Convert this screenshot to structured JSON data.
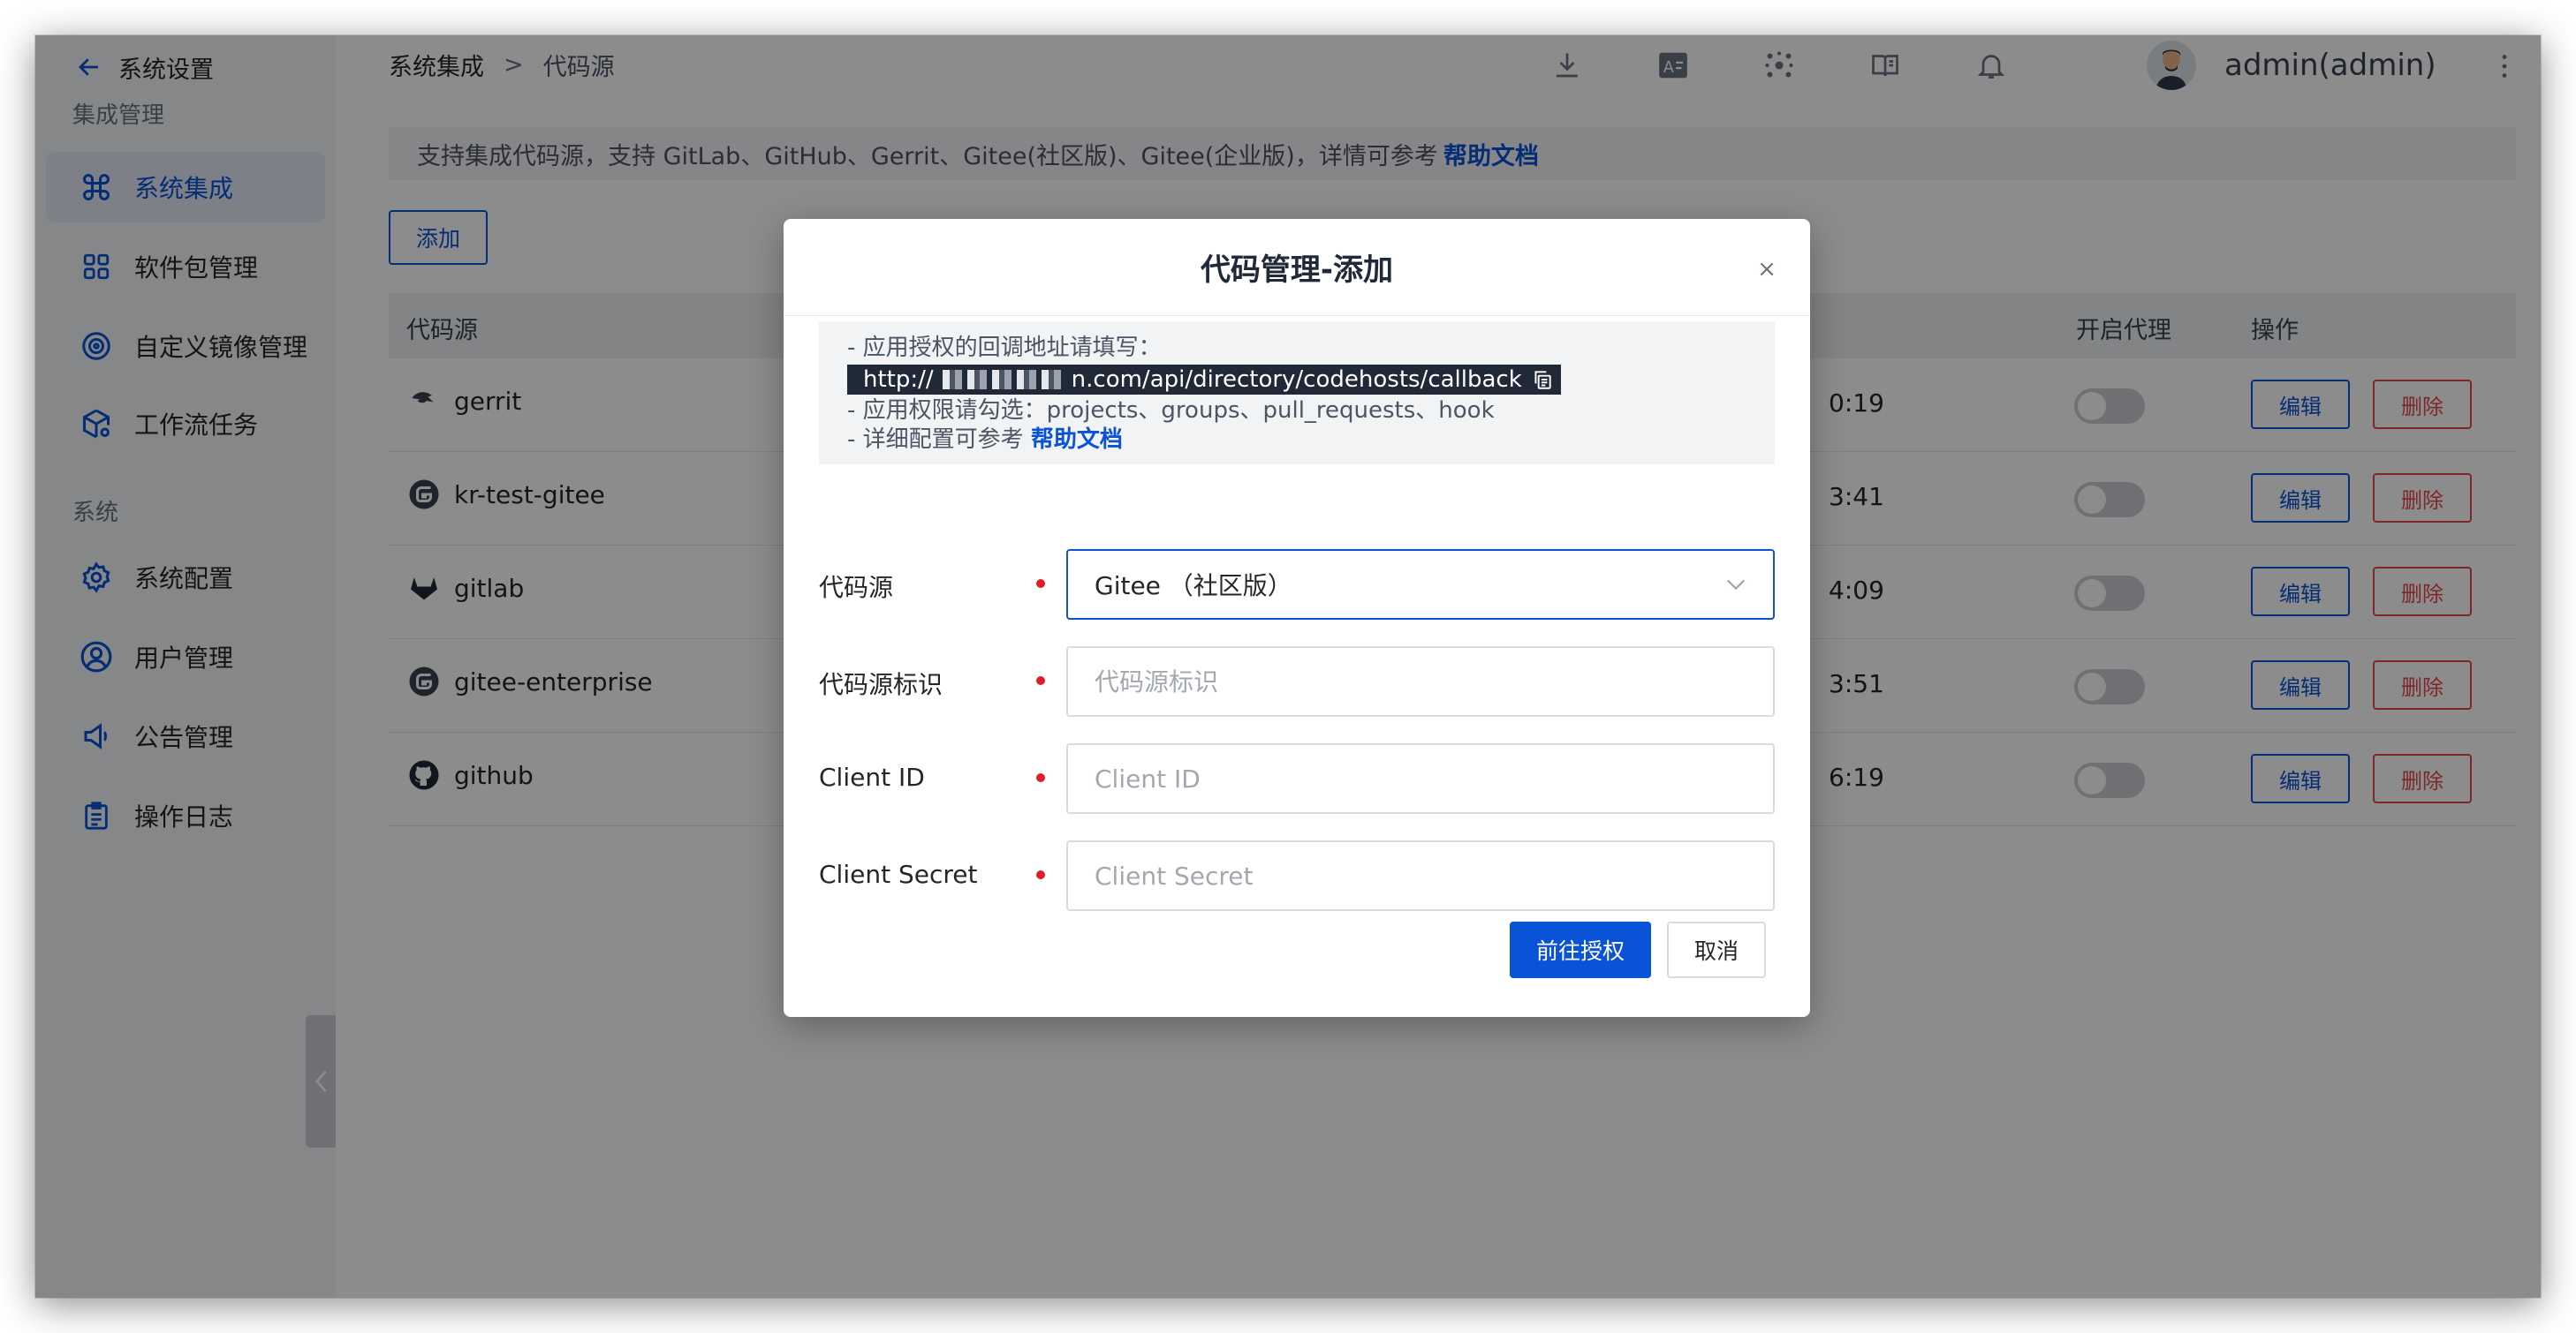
{
  "sidebar": {
    "back_label": "系统设置",
    "section_integration": "集成管理",
    "section_system": "系统",
    "items": [
      {
        "label": "系统集成",
        "icon": "command-icon",
        "active": true
      },
      {
        "label": "软件包管理",
        "icon": "grid-icon"
      },
      {
        "label": "自定义镜像管理",
        "icon": "disc-icon"
      },
      {
        "label": "工作流任务",
        "icon": "cube-gear-icon"
      },
      {
        "label": "系统配置",
        "icon": "gear-icon"
      },
      {
        "label": "用户管理",
        "icon": "user-icon"
      },
      {
        "label": "公告管理",
        "icon": "megaphone-icon"
      },
      {
        "label": "操作日志",
        "icon": "clipboard-icon"
      }
    ]
  },
  "topbar": {
    "breadcrumb_first": "系统集成",
    "breadcrumb_sep": ">",
    "breadcrumb_current": "代码源",
    "username": "admin(admin)"
  },
  "main": {
    "info_text": "支持集成代码源，支持 GitLab、GitHub、Gerrit、Gitee(社区版)、Gitee(企业版)，详情可参考",
    "info_link": "帮助文档",
    "add_label": "添加",
    "columns": {
      "source": "代码源",
      "proxy": "开启代理",
      "action": "操作"
    },
    "rows": [
      {
        "name": "gerrit",
        "icon": "gerrit-icon",
        "time": "0:19"
      },
      {
        "name": "kr-test-gitee",
        "icon": "gitee-icon",
        "time": "3:41"
      },
      {
        "name": "gitlab",
        "icon": "gitlab-icon",
        "time": "4:09"
      },
      {
        "name": "gitee-enterprise",
        "icon": "gitee-icon",
        "time": "3:51"
      },
      {
        "name": "github",
        "icon": "github-icon",
        "time": "6:19"
      }
    ],
    "edit_label": "编辑",
    "delete_label": "删除"
  },
  "modal": {
    "title": "代码管理-添加",
    "close": "×",
    "hint_line1": "- 应用授权的回调地址请填写：",
    "url_prefix": "http://",
    "url_suffix": "n.com/api/directory/codehosts/callback",
    "hint_line3": "- 应用权限请勾选：projects、groups、pull_requests、hook",
    "hint_line4": "- 详细配置可参考",
    "hint_link": "帮助文档",
    "fields": {
      "source_label": "代码源",
      "source_value": "Gitee （社区版）",
      "ident_label": "代码源标识",
      "ident_placeholder": "代码源标识",
      "client_id_label": "Client ID",
      "client_id_placeholder": "Client ID",
      "client_secret_label": "Client Secret",
      "client_secret_placeholder": "Client Secret"
    },
    "submit_label": "前往授权",
    "cancel_label": "取消"
  },
  "colors": {
    "accent": "#0a52d6",
    "danger": "#e5484d",
    "required": "#e11d2a"
  }
}
